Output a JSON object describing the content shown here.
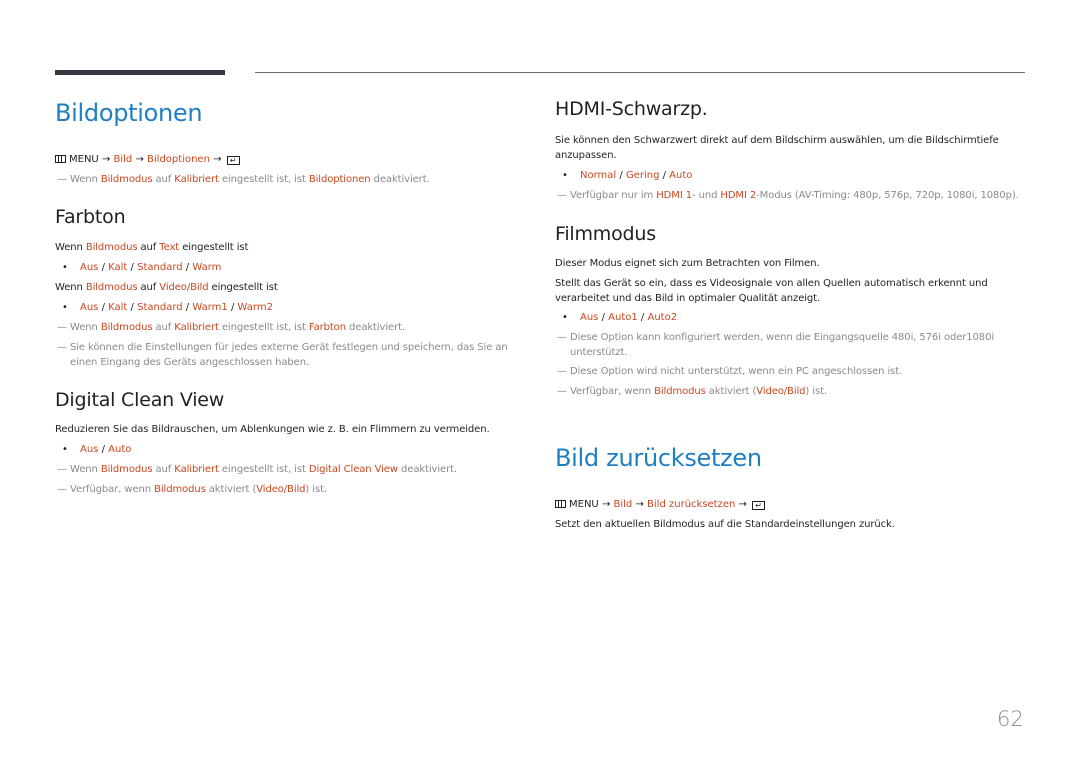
{
  "page_number": "62",
  "colors": {
    "heading_blue": "#1e7fc3",
    "highlight": "#c8471f",
    "note_gray": "#8a8a8a",
    "text": "#231f20"
  },
  "left": {
    "bildoptionen": {
      "title": "Bildoptionen",
      "menu_path": {
        "icon": "menu-icon",
        "menu": "MENU",
        "arrow": "→",
        "step1": "Bild",
        "step2": "Bildoptionen",
        "end_icon": "enter-icon"
      },
      "note1": {
        "t1": "Wenn ",
        "h1": "Bildmodus",
        "t2": " auf ",
        "h2": "Kalibriert",
        "t3": " eingestellt ist, ist ",
        "h3": "Bildoptionen",
        "t4": " deaktiviert."
      }
    },
    "farbton": {
      "title": "Farbton",
      "cond1": {
        "t1": "Wenn ",
        "h1": "Bildmodus",
        "t2": " auf ",
        "h2": "Text",
        "t3": " eingestellt ist"
      },
      "options1": [
        "Aus",
        "Kalt",
        "Standard",
        "Warm"
      ],
      "cond2": {
        "t1": "Wenn ",
        "h1": "Bildmodus",
        "t2": " auf ",
        "h2": "Video/Bild",
        "t3": " eingestellt ist"
      },
      "options2": [
        "Aus",
        "Kalt",
        "Standard",
        "Warm1",
        "Warm2"
      ],
      "note1": {
        "t1": "Wenn ",
        "h1": "Bildmodus",
        "t2": " auf ",
        "h2": "Kalibriert",
        "t3": " eingestellt ist, ist ",
        "h3": "Farbton",
        "t4": " deaktiviert."
      },
      "note2": "Sie können die Einstellungen für jedes externe Gerät festlegen und speichern, das Sie an einen Eingang des Geräts angeschlossen haben."
    },
    "dcv": {
      "title": "Digital Clean View",
      "desc": "Reduzieren Sie das Bildrauschen, um Ablenkungen wie z. B. ein Flimmern zu vermeiden.",
      "options": [
        "Aus",
        "Auto"
      ],
      "note1": {
        "t1": "Wenn ",
        "h1": "Bildmodus",
        "t2": " auf ",
        "h2": "Kalibriert",
        "t3": " eingestellt ist, ist ",
        "h3": "Digital Clean View",
        "t4": " deaktiviert."
      },
      "note2": {
        "t1": "Verfügbar, wenn ",
        "h1": "Bildmodus",
        "t2": " aktiviert (",
        "h2": "Video/Bild",
        "t3": ") ist."
      }
    }
  },
  "right": {
    "hdmi": {
      "title": "HDMI-Schwarzp.",
      "desc": "Sie können den Schwarzwert direkt auf dem Bildschirm auswählen, um die Bildschirmtiefe anzupassen.",
      "options": [
        "Normal",
        "Gering",
        "Auto"
      ],
      "note1": {
        "t1": "Verfügbar nur im ",
        "h1": "HDMI 1",
        "t2": "- und ",
        "h2": "HDMI 2",
        "t3": "-Modus (AV-Timing: 480p, 576p, 720p, 1080i, 1080p)."
      }
    },
    "filmmodus": {
      "title": "Filmmodus",
      "desc1": "Dieser Modus eignet sich zum Betrachten von Filmen.",
      "desc2": "Stellt das Gerät so ein, dass es Videosignale von allen Quellen automatisch erkennt und verarbeitet und das Bild in optimaler Qualität anzeigt.",
      "options": [
        "Aus",
        "Auto1",
        "Auto2"
      ],
      "note1": "Diese Option kann konfiguriert werden, wenn die Eingangsquelle 480i, 576i oder1080i unterstützt.",
      "note2": "Diese Option wird nicht unterstützt, wenn ein PC angeschlossen ist.",
      "note3": {
        "t1": "Verfügbar, wenn ",
        "h1": "Bildmodus",
        "t2": " aktiviert (",
        "h2": "Video/Bild",
        "t3": ") ist."
      }
    },
    "reset": {
      "title": "Bild zurücksetzen",
      "menu_path": {
        "icon": "menu-icon",
        "menu": "MENU",
        "arrow": "→",
        "step1": "Bild",
        "step2": "Bild zurücksetzen",
        "end_icon": "enter-icon"
      },
      "desc": "Setzt den aktuellen Bildmodus auf die Standardeinstellungen zurück."
    }
  },
  "separator": "/",
  "bullet": "•",
  "note_dash": "—"
}
